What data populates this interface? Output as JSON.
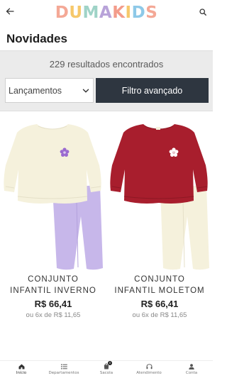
{
  "header": {
    "logo_letters": [
      "D",
      "U",
      "M",
      "A",
      "K",
      "I",
      "D",
      "S"
    ],
    "logo_colors": [
      "#f4a896",
      "#f6c86a",
      "#9fd3c7",
      "#b8a3d9",
      "#f39c8b",
      "#f6c86a",
      "#8ec9e8",
      "#f4a896"
    ]
  },
  "page": {
    "title": "Novidades"
  },
  "filters": {
    "results_text": "229 resultados encontrados",
    "sort_selected": "Lançamentos",
    "filter_button_label": "Filtro avançado"
  },
  "products": [
    {
      "name_line1": "CONJUNTO",
      "name_line2": "INFANTIL INVERNO",
      "price": "R$ 66,41",
      "installments": "ou 6x de R$ 11,65"
    },
    {
      "name_line1": "CONJUNTO",
      "name_line2": "INFANTIL MOLETOM",
      "price": "R$ 66,41",
      "installments": "ou 6x de R$ 11,65"
    }
  ],
  "bottom_nav": {
    "items": [
      {
        "label": "Início",
        "icon": "home-icon",
        "active": true
      },
      {
        "label": "Departamentos",
        "icon": "list-icon",
        "active": false
      },
      {
        "label": "Sacola",
        "icon": "bag-icon",
        "active": false,
        "badge": "0"
      },
      {
        "label": "Atendimento",
        "icon": "headset-icon",
        "active": false
      },
      {
        "label": "Conta",
        "icon": "user-icon",
        "active": false
      }
    ]
  }
}
